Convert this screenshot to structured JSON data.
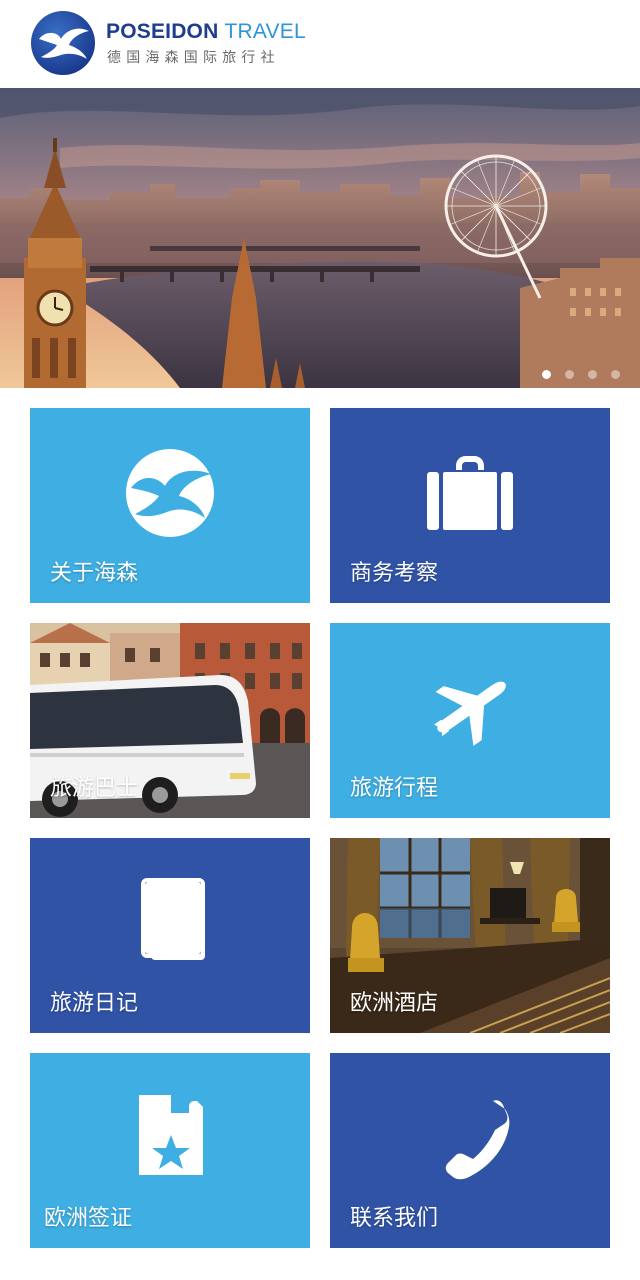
{
  "header": {
    "brand_main": "POSEIDON",
    "brand_second": "TRAVEL",
    "brand_sub": "德国海森国际旅行社"
  },
  "banner": {
    "slides_total": 4,
    "active_slide": 1
  },
  "tiles": [
    {
      "label": "关于海森",
      "icon": "poseidon-logo-icon",
      "color": "#3eaee3"
    },
    {
      "label": "商务考察",
      "icon": "suitcase-icon",
      "color": "#3053a6"
    },
    {
      "label": "旅游巴士",
      "icon": "bus-photo",
      "color": "#3eaee3"
    },
    {
      "label": "旅游行程",
      "icon": "airplane-icon",
      "color": "#3eaee3"
    },
    {
      "label": "旅游日记",
      "icon": "book-icon",
      "color": "#3053a6"
    },
    {
      "label": "欧洲酒店",
      "icon": "hotel-photo",
      "color": "#3053a6"
    },
    {
      "label": "欧洲签证",
      "icon": "visa-document-star-icon",
      "color": "#3eaee3"
    },
    {
      "label": "联系我们",
      "icon": "phone-icon",
      "color": "#3053a6"
    }
  ],
  "colors": {
    "light_blue": "#3eaee3",
    "dark_blue": "#3053a6",
    "brand_navy": "#1f3d8f"
  }
}
